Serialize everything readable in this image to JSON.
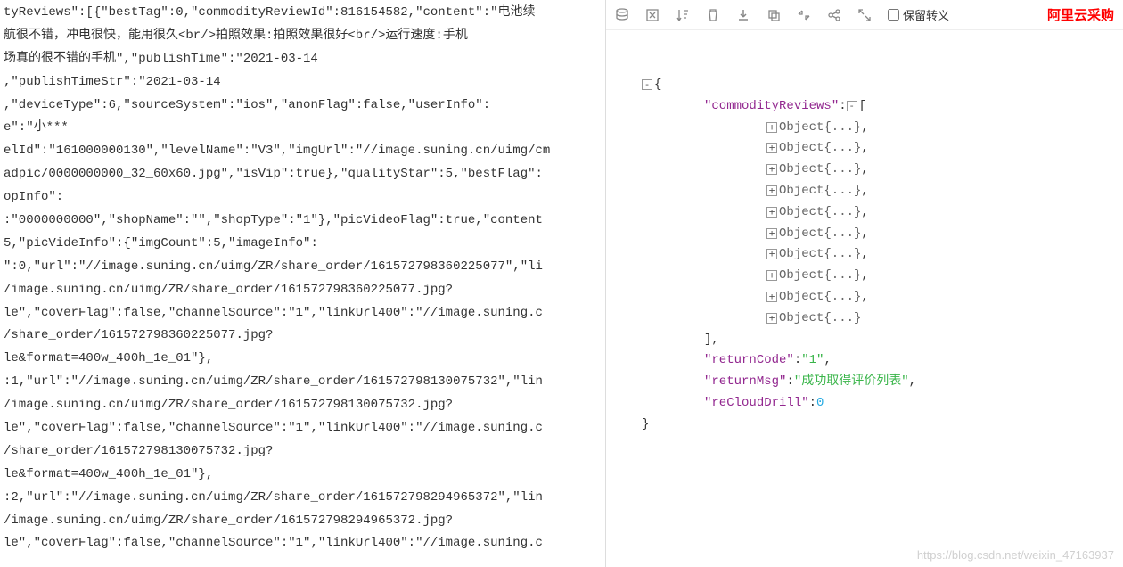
{
  "left_raw_text": "tyReviews\":[{\"bestTag\":0,\"commodityReviewId\":816154582,\"content\":\"电池续\n航很不错，冲电很快，能用很久<br/>拍照效果:拍照效果很好<br/>运行速度:手机\n场真的很不错的手机\",\"publishTime\":\"2021-03-14\n,\"publishTimeStr\":\"2021-03-14\n,\"deviceType\":6,\"sourceSystem\":\"ios\",\"anonFlag\":false,\"userInfo\":\ne\":\"小***\nelId\":\"161000000130\",\"levelName\":\"V3\",\"imgUrl\":\"//image.suning.cn/uimg/cm\nadpic/0000000000_32_60x60.jpg\",\"isVip\":true},\"qualityStar\":5,\"bestFlag\":\nopInfo\":\n:\"0000000000\",\"shopName\":\"\",\"shopType\":\"1\"},\"picVideoFlag\":true,\"content\n5,\"picVideInfo\":{\"imgCount\":5,\"imageInfo\":\n\":0,\"url\":\"//image.suning.cn/uimg/ZR/share_order/161572798360225077\",\"li\n/image.suning.cn/uimg/ZR/share_order/161572798360225077.jpg?\nle\",\"coverFlag\":false,\"channelSource\":\"1\",\"linkUrl400\":\"//image.suning.c\n/share_order/161572798360225077.jpg?\nle&format=400w_400h_1e_01\"},\n:1,\"url\":\"//image.suning.cn/uimg/ZR/share_order/161572798130075732\",\"lin\n/image.suning.cn/uimg/ZR/share_order/161572798130075732.jpg?\nle\",\"coverFlag\":false,\"channelSource\":\"1\",\"linkUrl400\":\"//image.suning.c\n/share_order/161572798130075732.jpg?\nle&format=400w_400h_1e_01\"},\n:2,\"url\":\"//image.suning.cn/uimg/ZR/share_order/161572798294965372\",\"lin\n/image.suning.cn/uimg/ZR/share_order/161572798294965372.jpg?\nle\",\"coverFlag\":false,\"channelSource\":\"1\",\"linkUrl400\":\"//image.suning.c",
  "toolbar": {
    "preserve_escape_label": "保留转义",
    "brand_text": "阿里云采购"
  },
  "tree": {
    "root_key": "commodityReviews",
    "collapsed_label": "Object{...}",
    "object_count": 10,
    "returnCode_key": "returnCode",
    "returnCode_val": "1",
    "returnMsg_key": "returnMsg",
    "returnMsg_val": "成功取得评价列表",
    "reCloudDrill_key": "reCloudDrill",
    "reCloudDrill_val": "0"
  },
  "watermark": "https://blog.csdn.net/weixin_47163937"
}
